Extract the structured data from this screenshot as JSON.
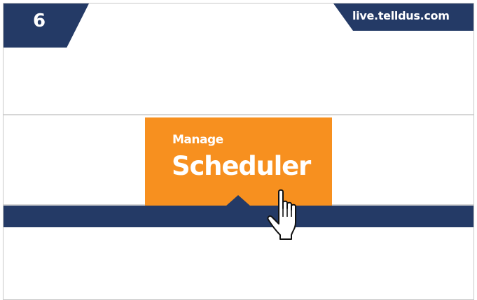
{
  "header": {
    "step_number": "6",
    "url": "live.telldus.com"
  },
  "menu": {
    "subtitle": "Manage",
    "title": "Scheduler"
  },
  "colors": {
    "navy": "#243a66",
    "accent": "#f7901f"
  },
  "icons": {
    "cursor": "hand-pointer-icon"
  }
}
